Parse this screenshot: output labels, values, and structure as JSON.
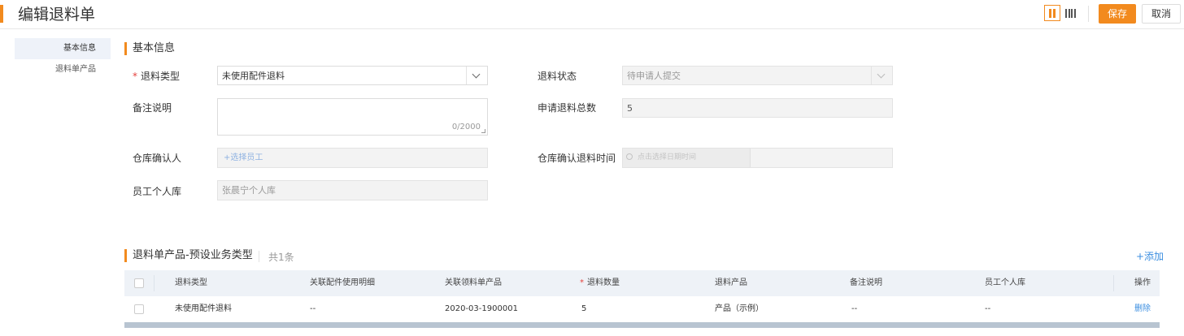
{
  "header": {
    "title": "编辑退料单",
    "save_label": "保存",
    "cancel_label": "取消"
  },
  "sidebar": {
    "items": [
      {
        "label": "基本信息",
        "active": true
      },
      {
        "label": "退料单产品",
        "active": false
      }
    ]
  },
  "basic": {
    "section_title": "基本信息",
    "return_type": {
      "label": "退料类型",
      "required": "*",
      "value": "未使用配件退料"
    },
    "return_status": {
      "label": "退料状态",
      "value": "待申请人提交"
    },
    "remark": {
      "label": "备注说明",
      "value": "",
      "counter": "0/2000"
    },
    "total_qty": {
      "label": "申请退料总数",
      "value": "5"
    },
    "warehouse_confirmer": {
      "label": "仓库确认人",
      "placeholder": "+选择员工"
    },
    "warehouse_confirm_time": {
      "label": "仓库确认退料时间",
      "placeholder": "点击选择日期时间"
    },
    "employee_store": {
      "label": "员工个人库",
      "value": "张晨宁个人库"
    }
  },
  "products": {
    "section_title": "退料单产品-预设业务类型",
    "count": "共1条",
    "add_label": "+添加",
    "columns": [
      "退料类型",
      "关联配件使用明细",
      "关联领料单产品",
      "退料数量",
      "退料产品",
      "备注说明",
      "员工个人库",
      "操作"
    ],
    "rows": [
      {
        "return_type": "未使用配件退料",
        "usage_detail": "--",
        "pick_product": "2020-03-1900001",
        "qty": "5",
        "product": "产品（示例）",
        "remark": "--",
        "store": "--",
        "action": "删除"
      }
    ]
  },
  "colors": {
    "accent": "#f28a1e",
    "link": "#3b8ee0",
    "required": "#e5413d"
  }
}
